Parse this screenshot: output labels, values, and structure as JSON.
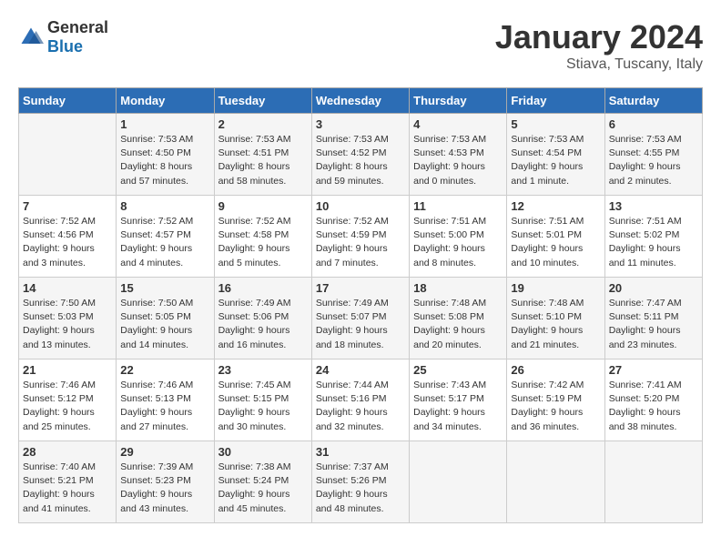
{
  "logo": {
    "text_general": "General",
    "text_blue": "Blue"
  },
  "title": "January 2024",
  "subtitle": "Stiava, Tuscany, Italy",
  "headers": [
    "Sunday",
    "Monday",
    "Tuesday",
    "Wednesday",
    "Thursday",
    "Friday",
    "Saturday"
  ],
  "weeks": [
    [
      {
        "day": "",
        "sunrise": "",
        "sunset": "",
        "daylight": ""
      },
      {
        "day": "1",
        "sunrise": "Sunrise: 7:53 AM",
        "sunset": "Sunset: 4:50 PM",
        "daylight": "Daylight: 8 hours and 57 minutes."
      },
      {
        "day": "2",
        "sunrise": "Sunrise: 7:53 AM",
        "sunset": "Sunset: 4:51 PM",
        "daylight": "Daylight: 8 hours and 58 minutes."
      },
      {
        "day": "3",
        "sunrise": "Sunrise: 7:53 AM",
        "sunset": "Sunset: 4:52 PM",
        "daylight": "Daylight: 8 hours and 59 minutes."
      },
      {
        "day": "4",
        "sunrise": "Sunrise: 7:53 AM",
        "sunset": "Sunset: 4:53 PM",
        "daylight": "Daylight: 9 hours and 0 minutes."
      },
      {
        "day": "5",
        "sunrise": "Sunrise: 7:53 AM",
        "sunset": "Sunset: 4:54 PM",
        "daylight": "Daylight: 9 hours and 1 minute."
      },
      {
        "day": "6",
        "sunrise": "Sunrise: 7:53 AM",
        "sunset": "Sunset: 4:55 PM",
        "daylight": "Daylight: 9 hours and 2 minutes."
      }
    ],
    [
      {
        "day": "7",
        "sunrise": "Sunrise: 7:52 AM",
        "sunset": "Sunset: 4:56 PM",
        "daylight": "Daylight: 9 hours and 3 minutes."
      },
      {
        "day": "8",
        "sunrise": "Sunrise: 7:52 AM",
        "sunset": "Sunset: 4:57 PM",
        "daylight": "Daylight: 9 hours and 4 minutes."
      },
      {
        "day": "9",
        "sunrise": "Sunrise: 7:52 AM",
        "sunset": "Sunset: 4:58 PM",
        "daylight": "Daylight: 9 hours and 5 minutes."
      },
      {
        "day": "10",
        "sunrise": "Sunrise: 7:52 AM",
        "sunset": "Sunset: 4:59 PM",
        "daylight": "Daylight: 9 hours and 7 minutes."
      },
      {
        "day": "11",
        "sunrise": "Sunrise: 7:51 AM",
        "sunset": "Sunset: 5:00 PM",
        "daylight": "Daylight: 9 hours and 8 minutes."
      },
      {
        "day": "12",
        "sunrise": "Sunrise: 7:51 AM",
        "sunset": "Sunset: 5:01 PM",
        "daylight": "Daylight: 9 hours and 10 minutes."
      },
      {
        "day": "13",
        "sunrise": "Sunrise: 7:51 AM",
        "sunset": "Sunset: 5:02 PM",
        "daylight": "Daylight: 9 hours and 11 minutes."
      }
    ],
    [
      {
        "day": "14",
        "sunrise": "Sunrise: 7:50 AM",
        "sunset": "Sunset: 5:03 PM",
        "daylight": "Daylight: 9 hours and 13 minutes."
      },
      {
        "day": "15",
        "sunrise": "Sunrise: 7:50 AM",
        "sunset": "Sunset: 5:05 PM",
        "daylight": "Daylight: 9 hours and 14 minutes."
      },
      {
        "day": "16",
        "sunrise": "Sunrise: 7:49 AM",
        "sunset": "Sunset: 5:06 PM",
        "daylight": "Daylight: 9 hours and 16 minutes."
      },
      {
        "day": "17",
        "sunrise": "Sunrise: 7:49 AM",
        "sunset": "Sunset: 5:07 PM",
        "daylight": "Daylight: 9 hours and 18 minutes."
      },
      {
        "day": "18",
        "sunrise": "Sunrise: 7:48 AM",
        "sunset": "Sunset: 5:08 PM",
        "daylight": "Daylight: 9 hours and 20 minutes."
      },
      {
        "day": "19",
        "sunrise": "Sunrise: 7:48 AM",
        "sunset": "Sunset: 5:10 PM",
        "daylight": "Daylight: 9 hours and 21 minutes."
      },
      {
        "day": "20",
        "sunrise": "Sunrise: 7:47 AM",
        "sunset": "Sunset: 5:11 PM",
        "daylight": "Daylight: 9 hours and 23 minutes."
      }
    ],
    [
      {
        "day": "21",
        "sunrise": "Sunrise: 7:46 AM",
        "sunset": "Sunset: 5:12 PM",
        "daylight": "Daylight: 9 hours and 25 minutes."
      },
      {
        "day": "22",
        "sunrise": "Sunrise: 7:46 AM",
        "sunset": "Sunset: 5:13 PM",
        "daylight": "Daylight: 9 hours and 27 minutes."
      },
      {
        "day": "23",
        "sunrise": "Sunrise: 7:45 AM",
        "sunset": "Sunset: 5:15 PM",
        "daylight": "Daylight: 9 hours and 30 minutes."
      },
      {
        "day": "24",
        "sunrise": "Sunrise: 7:44 AM",
        "sunset": "Sunset: 5:16 PM",
        "daylight": "Daylight: 9 hours and 32 minutes."
      },
      {
        "day": "25",
        "sunrise": "Sunrise: 7:43 AM",
        "sunset": "Sunset: 5:17 PM",
        "daylight": "Daylight: 9 hours and 34 minutes."
      },
      {
        "day": "26",
        "sunrise": "Sunrise: 7:42 AM",
        "sunset": "Sunset: 5:19 PM",
        "daylight": "Daylight: 9 hours and 36 minutes."
      },
      {
        "day": "27",
        "sunrise": "Sunrise: 7:41 AM",
        "sunset": "Sunset: 5:20 PM",
        "daylight": "Daylight: 9 hours and 38 minutes."
      }
    ],
    [
      {
        "day": "28",
        "sunrise": "Sunrise: 7:40 AM",
        "sunset": "Sunset: 5:21 PM",
        "daylight": "Daylight: 9 hours and 41 minutes."
      },
      {
        "day": "29",
        "sunrise": "Sunrise: 7:39 AM",
        "sunset": "Sunset: 5:23 PM",
        "daylight": "Daylight: 9 hours and 43 minutes."
      },
      {
        "day": "30",
        "sunrise": "Sunrise: 7:38 AM",
        "sunset": "Sunset: 5:24 PM",
        "daylight": "Daylight: 9 hours and 45 minutes."
      },
      {
        "day": "31",
        "sunrise": "Sunrise: 7:37 AM",
        "sunset": "Sunset: 5:26 PM",
        "daylight": "Daylight: 9 hours and 48 minutes."
      },
      {
        "day": "",
        "sunrise": "",
        "sunset": "",
        "daylight": ""
      },
      {
        "day": "",
        "sunrise": "",
        "sunset": "",
        "daylight": ""
      },
      {
        "day": "",
        "sunrise": "",
        "sunset": "",
        "daylight": ""
      }
    ]
  ]
}
